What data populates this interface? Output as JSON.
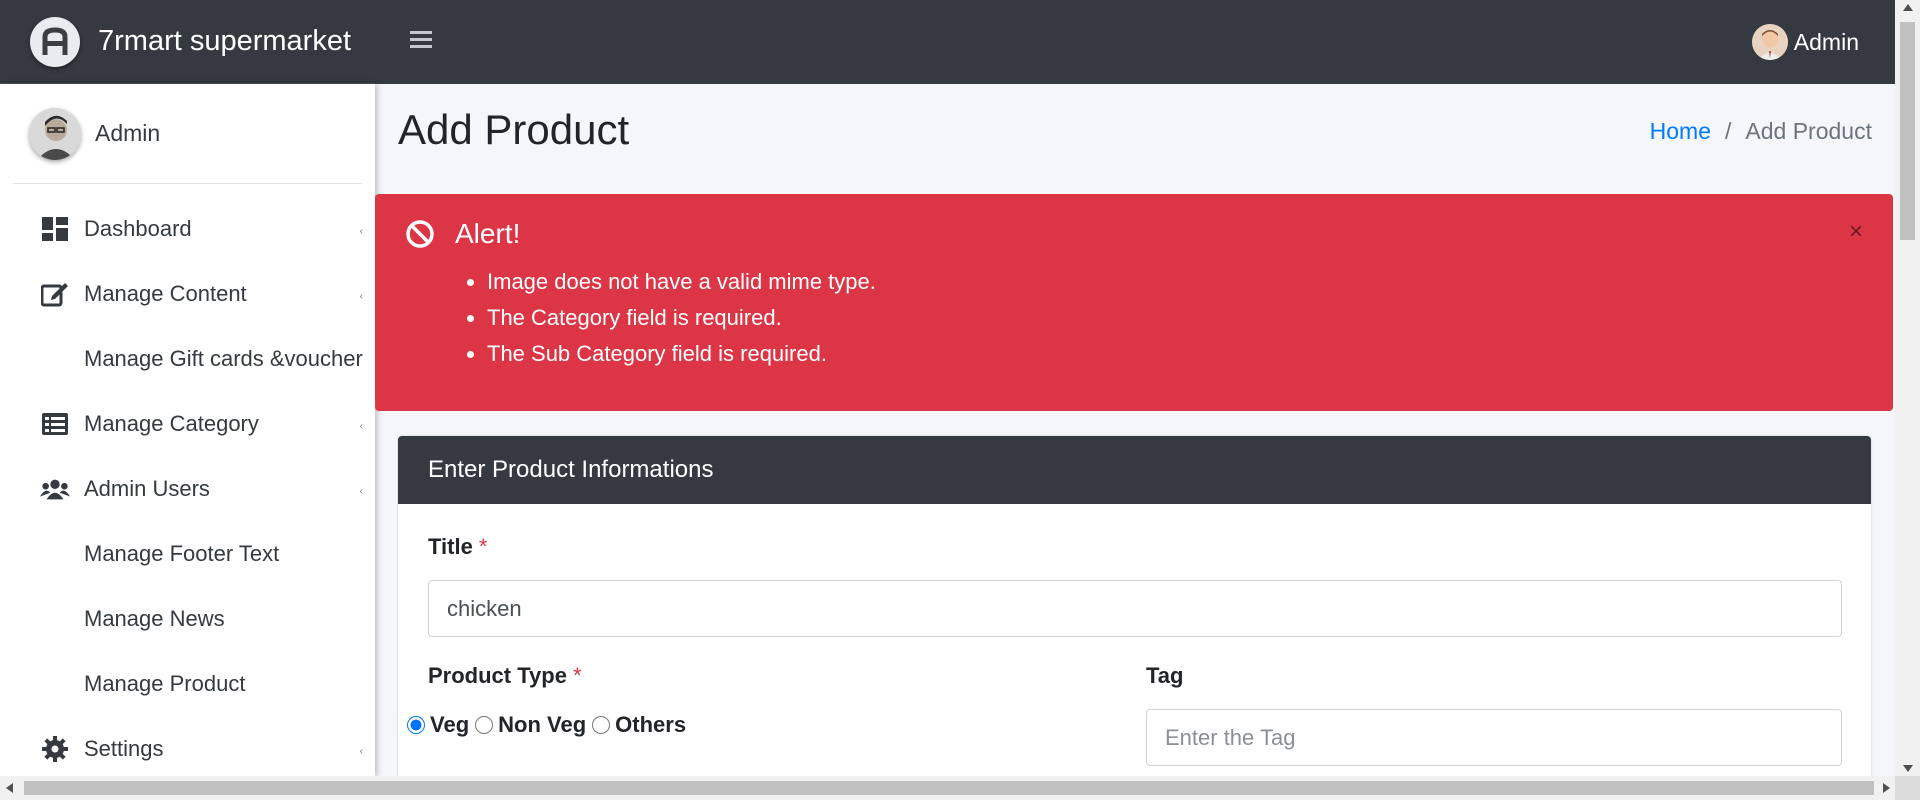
{
  "brand": {
    "name": "7rmart supermarket",
    "logo_icon": "brand-logo-icon"
  },
  "topbar": {
    "menu_icon": "hamburger-icon",
    "user_label": "Admin"
  },
  "sidebar": {
    "user": {
      "name": "Admin"
    },
    "items": [
      {
        "label": "Dashboard",
        "icon": "dashboard-icon",
        "has_submenu": true
      },
      {
        "label": "Manage Content",
        "icon": "edit-icon",
        "has_submenu": true
      },
      {
        "label": "Manage Gift cards &voucher",
        "icon": "",
        "has_submenu": false
      },
      {
        "label": "Manage Category",
        "icon": "list-icon",
        "has_submenu": true
      },
      {
        "label": "Admin Users",
        "icon": "users-icon",
        "has_submenu": true
      },
      {
        "label": "Manage Footer Text",
        "icon": "",
        "has_submenu": false
      },
      {
        "label": "Manage News",
        "icon": "",
        "has_submenu": false
      },
      {
        "label": "Manage Product",
        "icon": "",
        "has_submenu": false
      },
      {
        "label": "Settings",
        "icon": "gear-icon",
        "has_submenu": true
      }
    ]
  },
  "page": {
    "title": "Add Product",
    "breadcrumb": {
      "home": "Home",
      "current": "Add Product"
    }
  },
  "alert": {
    "title": "Alert!",
    "close": "×",
    "messages": [
      "Image does not have a valid mime type.",
      "The Category field is required.",
      "The Sub Category field is required."
    ],
    "color": "#dc3545"
  },
  "form": {
    "header": "Enter Product Informations",
    "title_label": "Title",
    "title_value": "chicken",
    "required_mark": "*",
    "product_type_label": "Product Type",
    "product_type_options": [
      "Veg",
      "Non Veg",
      "Others"
    ],
    "product_type_selected": "Veg",
    "tag_label": "Tag",
    "tag_placeholder": "Enter the Tag"
  },
  "colors": {
    "dark": "#343a40",
    "link": "#007bff",
    "danger": "#dc3545",
    "background": "#f4f6f9"
  }
}
